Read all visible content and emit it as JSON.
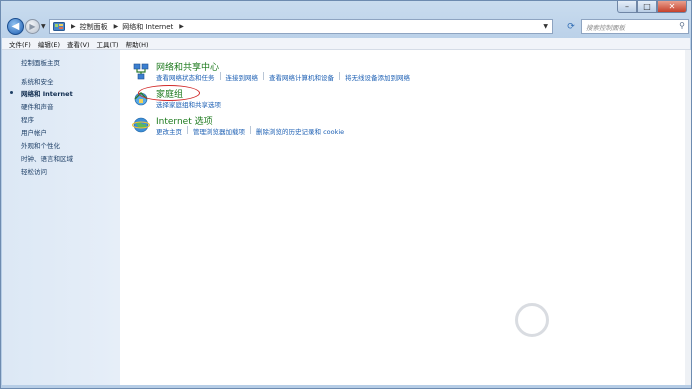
{
  "window": {
    "controls": {
      "minimize": "–",
      "maximize": "□",
      "close": "✕"
    }
  },
  "nav": {
    "back_icon": "back-arrow-icon",
    "forward_icon": "forward-arrow-icon",
    "breadcrumb": [
      "控制面板",
      "网络和 Internet"
    ],
    "search_placeholder": "搜索控制面板"
  },
  "menu": [
    "文件(F)",
    "编辑(E)",
    "查看(V)",
    "工具(T)",
    "帮助(H)"
  ],
  "sidebar": {
    "items": [
      {
        "label": "控制面板主页"
      },
      {
        "label": "系统和安全"
      },
      {
        "label": "网络和 Internet",
        "active": true
      },
      {
        "label": "硬件和声音"
      },
      {
        "label": "程序"
      },
      {
        "label": "用户帐户"
      },
      {
        "label": "外观和个性化"
      },
      {
        "label": "时钟、语言和区域"
      },
      {
        "label": "轻松访问"
      }
    ]
  },
  "categories": [
    {
      "title": "网络和共享中心",
      "icon": "network-sharing-center-icon",
      "links": [
        "查看网络状态和任务",
        "连接到网络",
        "查看网络计算机和设备",
        "将无线设备添加到网络"
      ]
    },
    {
      "title": "家庭组",
      "icon": "homegroup-icon",
      "links": [
        "选择家庭组和共享选项"
      ],
      "highlighted": true
    },
    {
      "title": "Internet 选项",
      "icon": "internet-options-icon",
      "links": [
        "更改主页",
        "管理浏览器加载项",
        "删除浏览的历史记录和 cookie"
      ]
    }
  ],
  "colors": {
    "link": "#1c5fb3",
    "category_title": "#1d7a1d",
    "highlight_ring": "#d12a2a"
  }
}
